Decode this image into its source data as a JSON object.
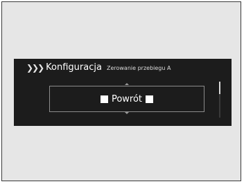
{
  "header": {
    "chevrons": "❯❯❯",
    "title": "Konfiguracja",
    "subtitle": "Zerowanie przebiegu A"
  },
  "option": {
    "label": "Powrót",
    "left_icon": "square-icon",
    "right_icon": "square-icon"
  },
  "scrollbar": {
    "position_fraction": 0.0
  },
  "colors": {
    "screen_background": "#1c1c1c",
    "frame_background": "#e6e6e6",
    "text": "#ffffff",
    "option_border": "#8c8c8c"
  }
}
